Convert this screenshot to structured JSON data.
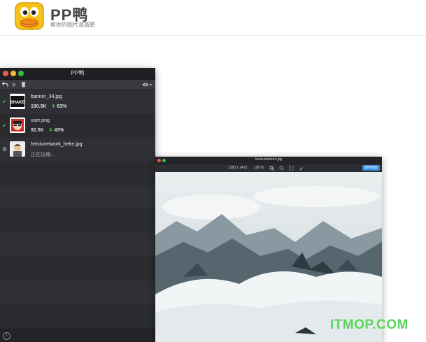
{
  "brand": {
    "title": "PP鸭",
    "subtitle": "帮你的图片减减肥",
    "logo_icon": "duck-logo-icon"
  },
  "app_window": {
    "title": "PP鸭",
    "toolbar": {
      "back_icon": "undo-arrow-icon",
      "play_icon": "play-icon",
      "trash_icon": "trash-icon",
      "view_icon": "eye-icon"
    },
    "files": [
      {
        "name": "banner_34.jpg",
        "size": "190.5K",
        "saving": "83%",
        "status": "done"
      },
      {
        "name": "user.png",
        "size": "92.5K",
        "saving": "43%",
        "status": "done"
      },
      {
        "name": "heixiunetwork_hehe.jpg",
        "progress_text": "正在压缩…",
        "status": "compressing"
      }
    ],
    "status_icons": {
      "done": "✔",
      "pending": "⚙"
    },
    "saving_arrow": "⬇",
    "info_icon_glyph": "i"
  },
  "preview_window": {
    "title": "heixiunetwork.jpg",
    "dimensions": "1280 x 2422",
    "zoom": "108 %",
    "save_button": "保存原图"
  },
  "watermark": "ITMOP.COM",
  "colors": {
    "accent_green": "#2fc440",
    "button_blue": "#3a8ee6",
    "window_dark": "#2a2b2f"
  }
}
